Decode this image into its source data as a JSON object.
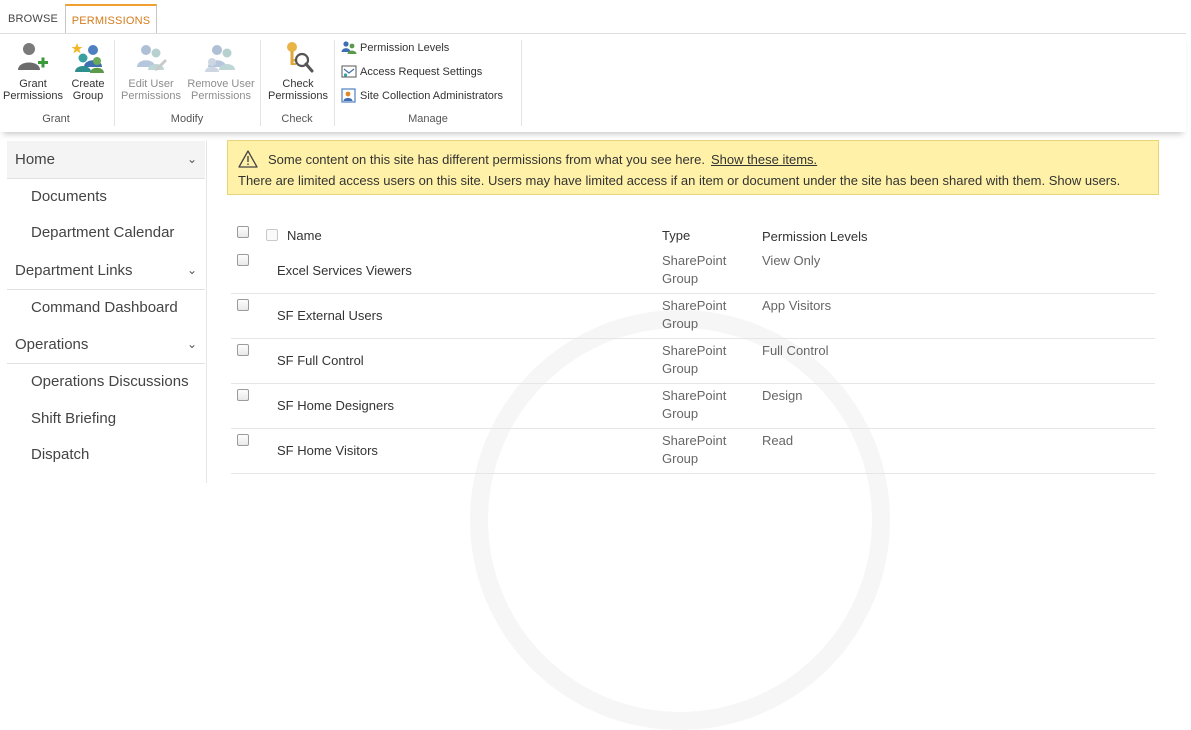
{
  "ribbon_tabs": {
    "browse": "BROWSE",
    "permissions": "PERMISSIONS"
  },
  "ribbon": {
    "grant": {
      "label": "Grant",
      "grant_permissions": {
        "line1": "Grant",
        "line2": "Permissions",
        "icon": "grant-permissions-icon"
      },
      "create_group": {
        "line1": "Create",
        "line2": "Group",
        "icon": "create-group-icon"
      }
    },
    "modify": {
      "label": "Modify",
      "edit_user_permissions": {
        "line1": "Edit User",
        "line2": "Permissions",
        "icon": "edit-user-permissions-icon"
      },
      "remove_user_permissions": {
        "line1": "Remove User",
        "line2": "Permissions",
        "icon": "remove-user-permissions-icon"
      }
    },
    "check": {
      "label": "Check",
      "check_permissions": {
        "line1": "Check",
        "line2": "Permissions",
        "icon": "check-permissions-icon"
      }
    },
    "manage": {
      "label": "Manage",
      "permission_levels": "Permission Levels",
      "access_request_settings": "Access Request Settings",
      "site_collection_administrators": "Site Collection Administrators"
    }
  },
  "nav": {
    "home": "Home",
    "documents": "Documents",
    "department_calendar": "Department Calendar",
    "department_links": "Department Links",
    "command_dashboard": "Command Dashboard",
    "operations": "Operations",
    "operations_discussions": "Operations Discussions",
    "shift_briefing": "Shift Briefing",
    "dispatch": "Dispatch"
  },
  "banner": {
    "line1": "Some content on this site has different permissions from what you see here.",
    "link": "Show these items.",
    "line2": "There are limited access users on this site. Users may have limited access if an item or document under the site has been shared with them. Show users."
  },
  "table": {
    "headers": {
      "name": "Name",
      "type": "Type",
      "permission_levels": "Permission Levels"
    },
    "rows": [
      {
        "name": "Excel Services Viewers",
        "type_line1": "SharePoint",
        "type_line2": "Group",
        "level": "View Only"
      },
      {
        "name": "SF External Users",
        "type_line1": "SharePoint",
        "type_line2": "Group",
        "level": "App Visitors"
      },
      {
        "name": "SF Full Control",
        "type_line1": "SharePoint",
        "type_line2": "Group",
        "level": "Full Control"
      },
      {
        "name": "SF Home Designers",
        "type_line1": "SharePoint",
        "type_line2": "Group",
        "level": "Design"
      },
      {
        "name": "SF Home Visitors",
        "type_line1": "SharePoint",
        "type_line2": "Group",
        "level": "Read"
      }
    ]
  },
  "colors": {
    "accent": "#d47c1c",
    "banner_bg": "#fff2a8",
    "ribbon_shadow": "#c8c8c8"
  }
}
